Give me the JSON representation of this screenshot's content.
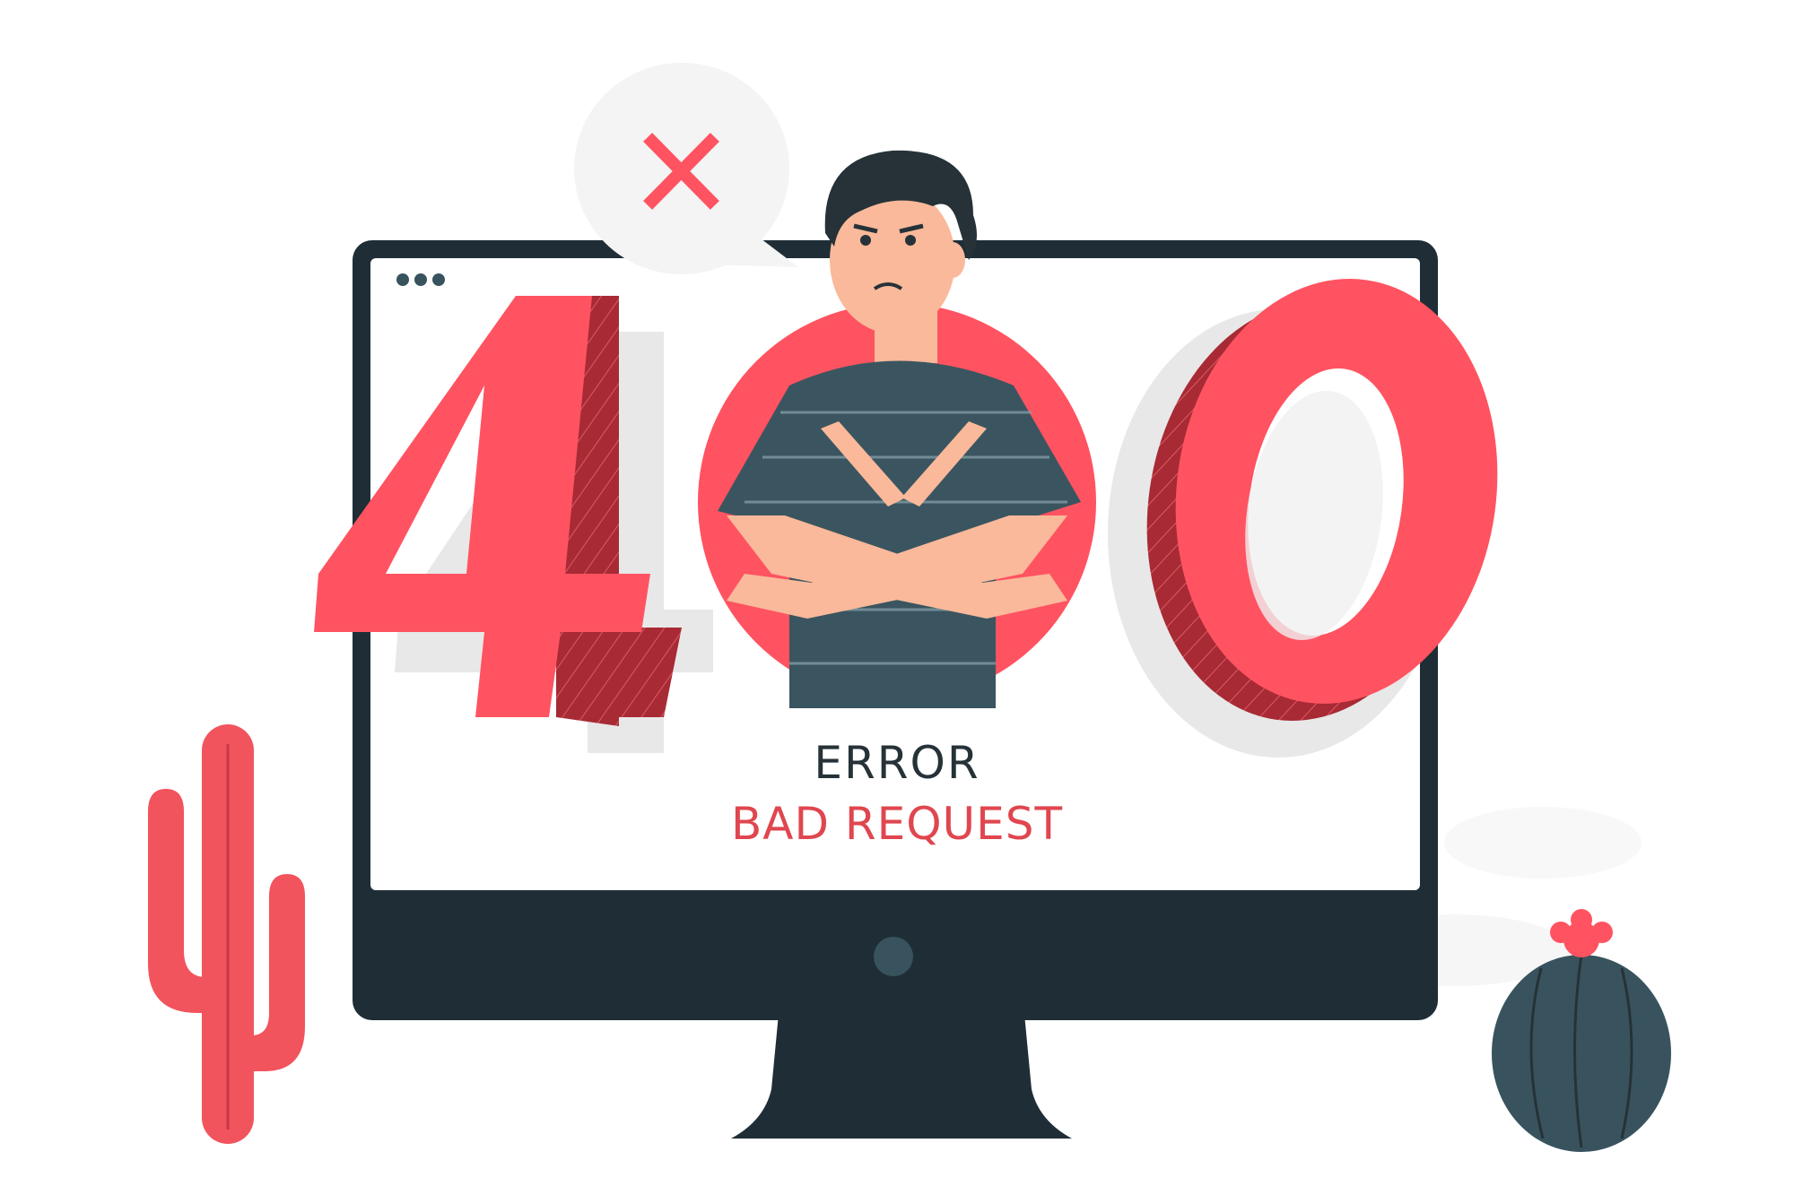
{
  "error_code": {
    "first_digit": "4",
    "middle_digit": "0",
    "last_digit": "0"
  },
  "message": {
    "title": "ERROR",
    "subtitle": "BAD REQUEST"
  },
  "colors": {
    "accent": "#ff5361",
    "accent_dark": "#a82a34",
    "monitor": "#1f2e36",
    "shirt": "#3b5560",
    "skin": "#f9b99a",
    "hair": "#263238",
    "cactus_red": "#f2545d",
    "cactus_round": "#38535e"
  },
  "icons": {
    "speech_bubble": "x-mark-icon",
    "window_dots": "window-controls-icon",
    "camera": "webcam-icon"
  }
}
